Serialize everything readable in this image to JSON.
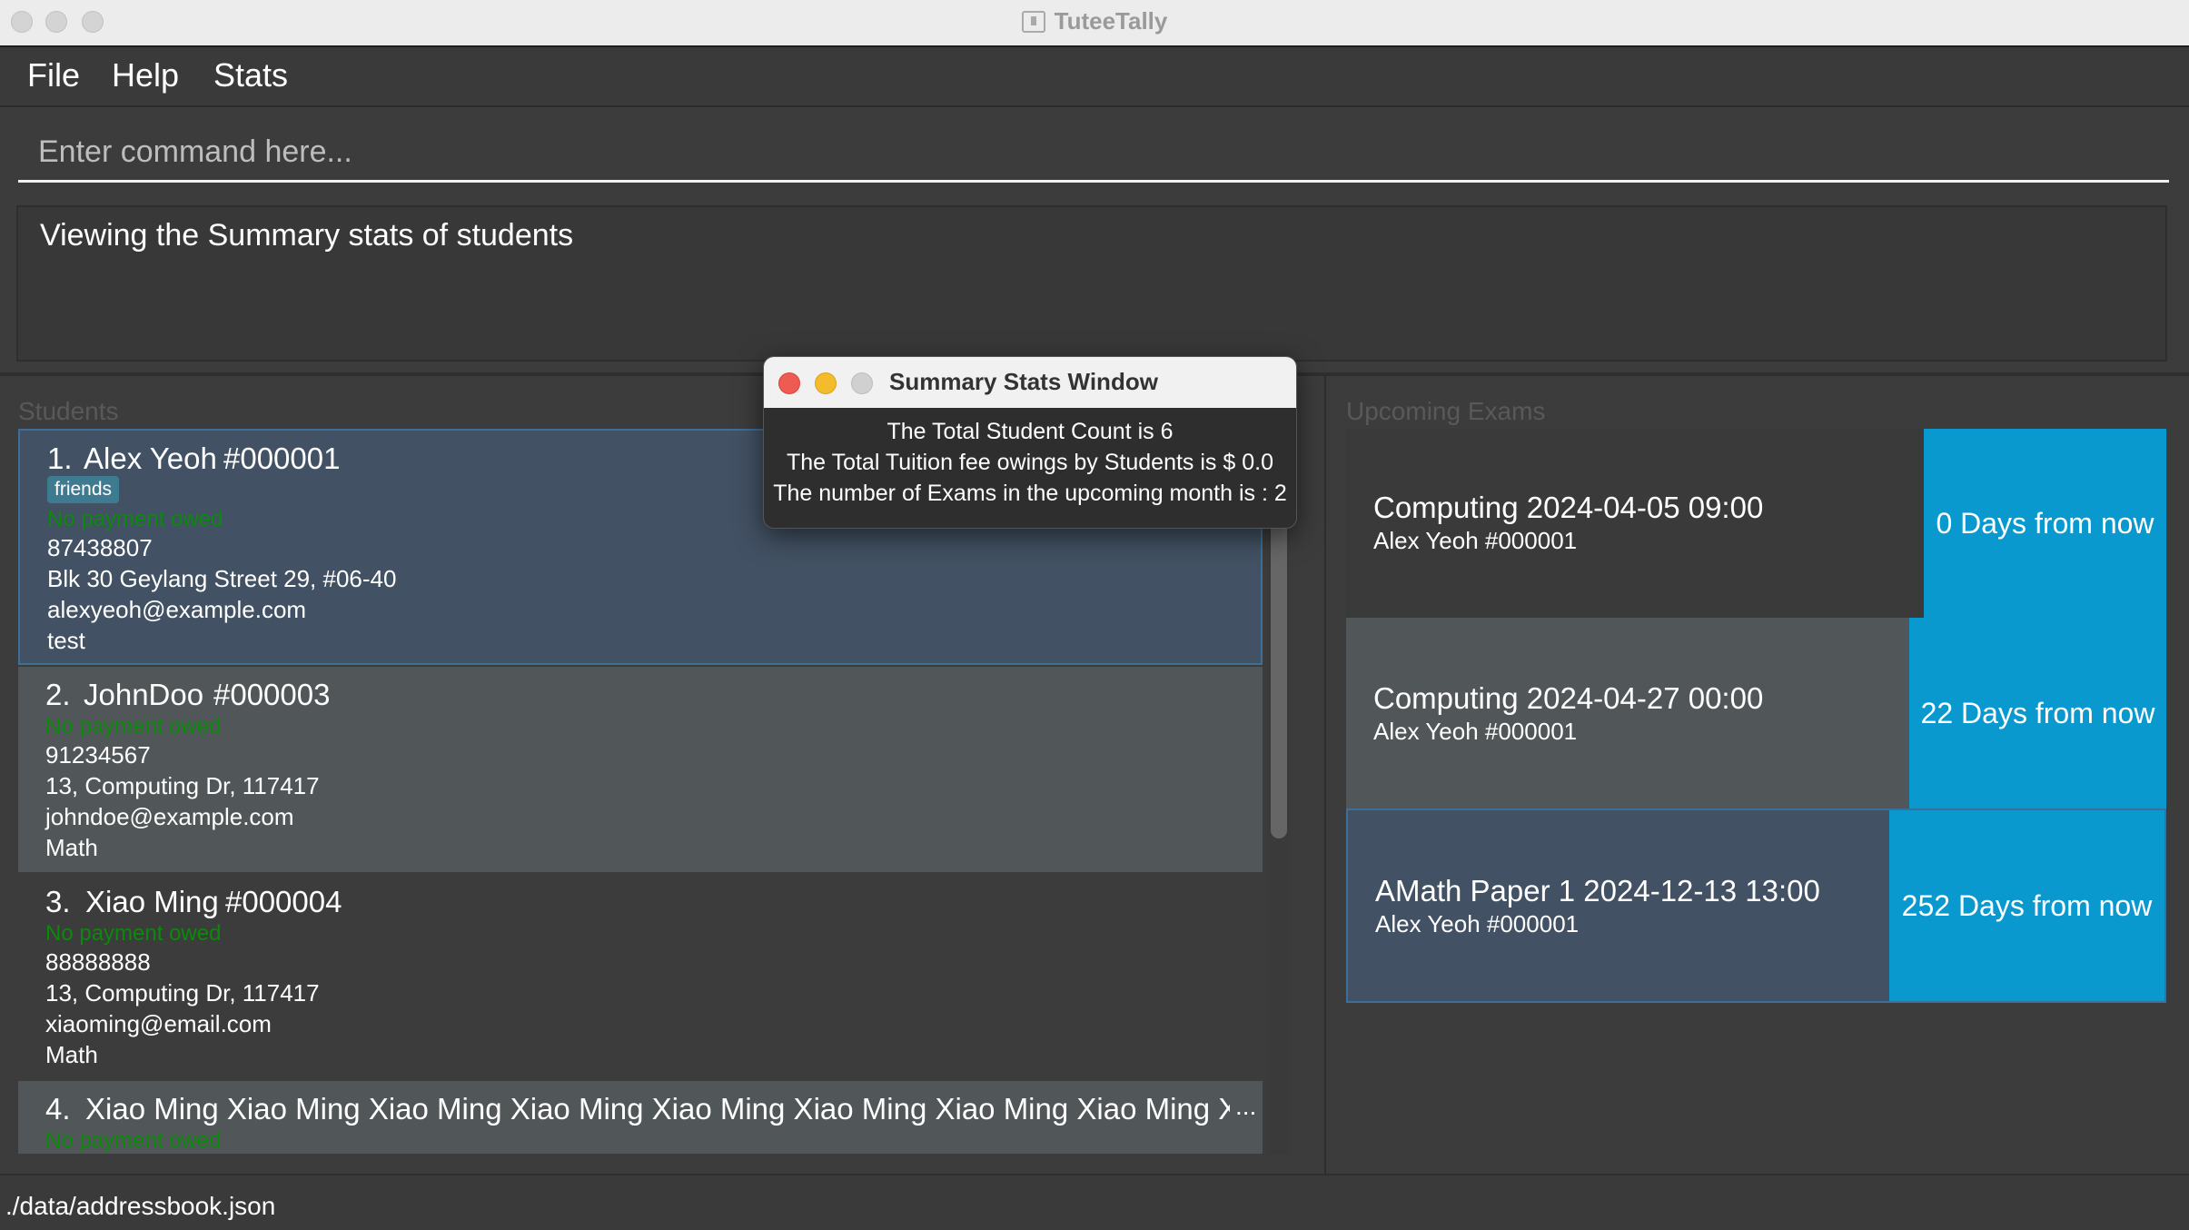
{
  "window": {
    "title": "TuteeTally"
  },
  "menu": {
    "file": "File",
    "help": "Help",
    "stats": "Stats"
  },
  "command": {
    "placeholder": "Enter command here...",
    "value": ""
  },
  "result": {
    "text": "Viewing the Summary stats of students"
  },
  "students": {
    "title": "Students",
    "items": [
      {
        "index": "1.",
        "name": "Alex Yeoh",
        "id": "#000001",
        "tag": "friends",
        "payment": "No payment owed",
        "phone": "87438807",
        "address": "Blk 30 Geylang Street 29, #06-40",
        "email": "alexyeoh@example.com",
        "subject": "test"
      },
      {
        "index": "2.",
        "name": "JohnDoo",
        "id": "#000003",
        "payment": "No payment owed",
        "phone": "91234567",
        "address": "13, Computing Dr, 117417",
        "email": "johndoe@example.com",
        "subject": "Math"
      },
      {
        "index": "3.",
        "name": "Xiao Ming",
        "id": "#000004",
        "payment": "No payment owed",
        "phone": "88888888",
        "address": "13, Computing Dr, 117417",
        "email": "xiaoming@email.com",
        "subject": "Math"
      },
      {
        "index": "4.",
        "name": "Xiao Ming Xiao Ming Xiao Ming Xiao Ming Xiao Ming Xiao Ming Xiao Ming Xiao Ming Xiao M...",
        "ellipsis": "...",
        "payment": "No payment owed"
      }
    ]
  },
  "exams": {
    "title": "Upcoming Exams",
    "items": [
      {
        "title": "Computing 2024-04-05 09:00",
        "student": "Alex Yeoh   #000001",
        "countdown": "0 Days from now"
      },
      {
        "title": "Computing 2024-04-27 00:00",
        "student": "Alex Yeoh   #000001",
        "countdown": "22 Days from now"
      },
      {
        "title": "AMath Paper 1 2024-12-13 13:00",
        "student": "Alex Yeoh   #000001",
        "countdown": "252 Days from now"
      }
    ]
  },
  "status": {
    "path": "./data/addressbook.json"
  },
  "popup": {
    "title": "Summary Stats Window",
    "lines": [
      "The Total Student Count is 6",
      "The Total Tuition fee owings by Students is $ 0.0",
      "The number of Exams in the upcoming month is : 2"
    ]
  },
  "colors": {
    "background": "#3c3c3c",
    "accent_blue": "#0a99cf",
    "payment_green": "#0a8a0a",
    "tag_blue": "#3e7b91",
    "selected_card": "#425163"
  },
  "icons": {
    "app": "app-icon",
    "close": "close-icon",
    "minimize": "minimize-icon",
    "zoom": "zoom-icon"
  }
}
